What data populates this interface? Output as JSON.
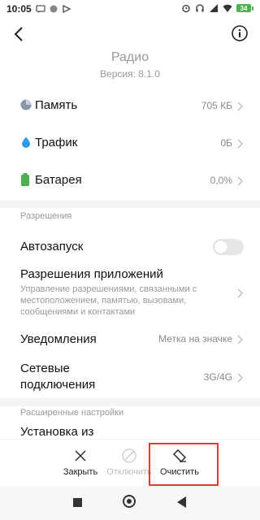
{
  "status_bar": {
    "time": "10:05",
    "battery": "34"
  },
  "header": {
    "title": "Радио",
    "version": "Версия: 8.1.0"
  },
  "stats": [
    {
      "label": "Память",
      "value": "705 КБ"
    },
    {
      "label": "Трафик",
      "value": "0Б"
    },
    {
      "label": "Батарея",
      "value": "0,0%"
    }
  ],
  "permissions": {
    "section_title": "Разрешения",
    "autostart_label": "Автозапуск",
    "autostart_enabled": false,
    "app_permissions_label": "Разрешения приложений",
    "app_permissions_sub": "Управление разрешениями, связанными с местоположением, памятью, вызовами, сообщениями и контактами",
    "notifications_label": "Уведомления",
    "notifications_value": "Метка на значке",
    "network_label_line1": "Сетевые",
    "network_label_line2": "подключения",
    "network_value": "3G/4G"
  },
  "advanced": {
    "section_title": "Расширенные настройки",
    "install_label": "Установка из"
  },
  "actions": {
    "close": "Закрыть",
    "disable": "Отключить",
    "clear": "Очистить"
  },
  "colors": {
    "accent_highlight": "#e53935",
    "battery_green": "#4caf50",
    "drop_blue": "#2f9be6",
    "memory_gray": "#8a97a8"
  }
}
